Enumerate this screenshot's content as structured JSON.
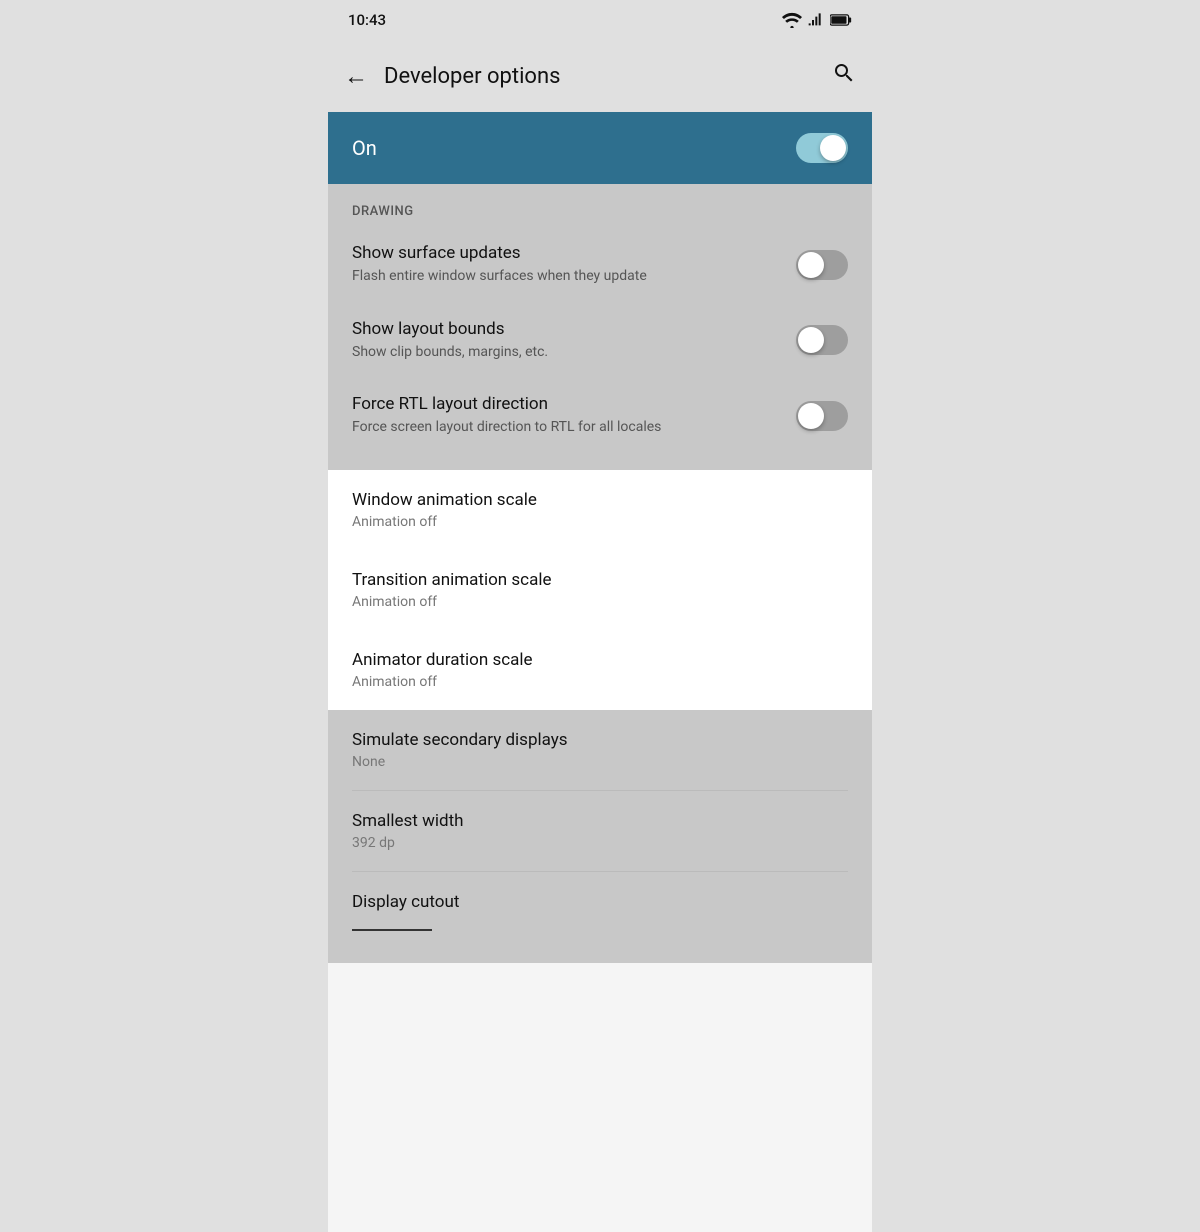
{
  "statusBar": {
    "time": "10:43"
  },
  "appBar": {
    "title": "Developer options",
    "backLabel": "←",
    "searchLabel": "🔍"
  },
  "toggleHeader": {
    "label": "On",
    "state": "on"
  },
  "drawing": {
    "sectionLabel": "DRAWING",
    "items": [
      {
        "title": "Show surface updates",
        "subtitle": "Flash entire window surfaces when they update",
        "toggleState": "off"
      },
      {
        "title": "Show layout bounds",
        "subtitle": "Show clip bounds, margins, etc.",
        "toggleState": "off"
      },
      {
        "title": "Force RTL layout direction",
        "subtitle": "Force screen layout direction to RTL for all locales",
        "toggleState": "off"
      }
    ]
  },
  "animationSettings": {
    "items": [
      {
        "title": "Window animation scale",
        "subtitle": "Animation off"
      },
      {
        "title": "Transition animation scale",
        "subtitle": "Animation off"
      },
      {
        "title": "Animator duration scale",
        "subtitle": "Animation off"
      }
    ]
  },
  "displaySettings": {
    "items": [
      {
        "title": "Simulate secondary displays",
        "subtitle": "None"
      },
      {
        "title": "Smallest width",
        "subtitle": "392 dp"
      },
      {
        "title": "Display cutout",
        "subtitle": ""
      }
    ]
  }
}
